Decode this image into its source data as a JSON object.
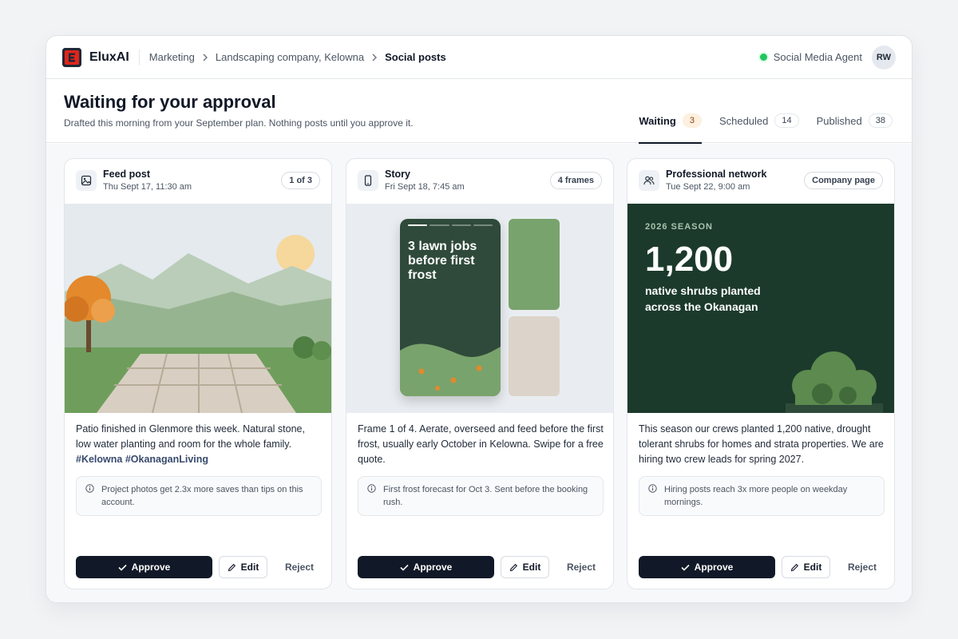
{
  "brand": {
    "name": "EluxAI",
    "logo_letter": "E",
    "accent": "#e1251b"
  },
  "breadcrumb": {
    "items": [
      "Marketing",
      "Landscaping company, Kelowna"
    ],
    "current": "Social posts"
  },
  "agent": {
    "name": "Social Media Agent",
    "status_color": "#22c55e"
  },
  "user": {
    "initials": "RW"
  },
  "header": {
    "title": "Waiting for your approval",
    "subtitle": "Drafted this morning from your September plan. Nothing posts until you approve it."
  },
  "tabs": [
    {
      "label": "Waiting",
      "count": "3",
      "active": true
    },
    {
      "label": "Scheduled",
      "count": "14"
    },
    {
      "label": "Published",
      "count": "38"
    }
  ],
  "cards": [
    {
      "type": "Feed post",
      "icon": "image-icon",
      "date": "Thu Sept 17, 11:30 am",
      "badge": "1 of 3",
      "text": "Patio finished in Glenmore this week. Natural stone, low water planting and room for the whole family.",
      "hashtags": "#Kelowna #OkanaganLiving",
      "tip": "Project photos get 2.3x more saves than tips on this account."
    },
    {
      "type": "Story",
      "icon": "phone-icon",
      "date": "Fri Sept 18, 7:45 am",
      "badge": "4 frames",
      "story_headline": "3 lawn jobs before first frost",
      "text": "Frame 1 of 4. Aerate, overseed and feed before the first frost, usually early October in Kelowna. Swipe for a free quote.",
      "tip": "First frost forecast for Oct 3. Sent before the booking rush."
    },
    {
      "type": "Professional network",
      "icon": "users-icon",
      "date": "Tue Sept 22, 9:00 am",
      "badge": "Company page",
      "media_season": "2026 SEASON",
      "media_number": "1,200",
      "media_caption": "native shrubs planted across the Okanagan",
      "text": "This season our crews planted 1,200 native, drought tolerant shrubs for homes and strata properties. We are hiring two crew leads for spring 2027.",
      "tip": "Hiring posts reach 3x more people on weekday mornings."
    }
  ],
  "actions": {
    "approve": "Approve",
    "edit": "Edit",
    "reject": "Reject"
  }
}
